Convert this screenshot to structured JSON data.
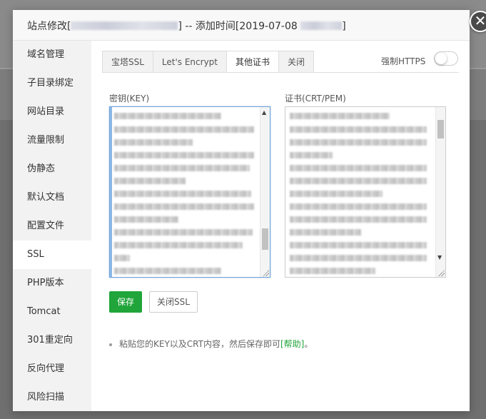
{
  "dialog": {
    "title_prefix": "站点修改[",
    "title_suffix": "] -- 添加时间[2019-07-08",
    "close_glyph": "✕"
  },
  "sidebar": {
    "items": [
      {
        "label": "域名管理"
      },
      {
        "label": "子目录绑定"
      },
      {
        "label": "网站目录"
      },
      {
        "label": "流量限制"
      },
      {
        "label": "伪静态"
      },
      {
        "label": "默认文档"
      },
      {
        "label": "配置文件"
      },
      {
        "label": "SSL"
      },
      {
        "label": "PHP版本"
      },
      {
        "label": "Tomcat"
      },
      {
        "label": "301重定向"
      },
      {
        "label": "反向代理"
      },
      {
        "label": "风险扫描"
      }
    ],
    "active": "SSL"
  },
  "tabs": [
    {
      "label": "宝塔SSL"
    },
    {
      "label": "Let's Encrypt"
    },
    {
      "label": "其他证书"
    },
    {
      "label": "关闭"
    }
  ],
  "active_tab": "其他证书",
  "force_https": {
    "label": "强制HTTPS",
    "enabled": false
  },
  "key_field": {
    "label": "密钥(KEY)"
  },
  "cert_field": {
    "label": "证书(CRT/PEM)"
  },
  "buttons": {
    "save": "保存",
    "close_ssl": "关闭SSL"
  },
  "tip": {
    "text": "粘贴您的KEY以及CRT内容，然后保存即可",
    "link": "[帮助]",
    "end": "。"
  },
  "colors": {
    "accent": "#20a53a",
    "focus": "#6fa4d6"
  }
}
